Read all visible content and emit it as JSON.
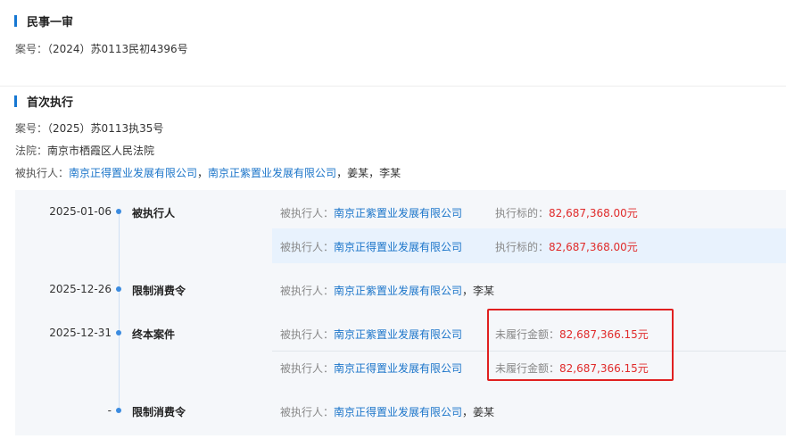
{
  "section1": {
    "title": "民事一审",
    "case_label": "案号：",
    "case_no": "（2024）苏0113民初4396号"
  },
  "section2": {
    "title": "首次执行",
    "case_label": "案号：",
    "case_no": "（2025）苏0113执35号",
    "court_label": "法院：",
    "court": "南京市栖霞区人民法院",
    "executed_label": "被执行人：",
    "executed_company1": "南京正得置业发展有限公司",
    "sep1": "，",
    "executed_company2": "南京正紫置业发展有限公司",
    "executed_rest": "，姜某，李某"
  },
  "timeline": [
    {
      "date": "2025-01-06",
      "type": "被执行人",
      "rows": [
        {
          "label": "被执行人：",
          "company": "南京正紫置业发展有限公司",
          "amount_label": "执行标的：",
          "amount": "82,687,368.00元"
        },
        {
          "label": "被执行人：",
          "company": "南京正得置业发展有限公司",
          "amount_label": "执行标的：",
          "amount": "82,687,368.00元"
        }
      ]
    },
    {
      "date": "2025-12-26",
      "type": "限制消费令",
      "rows": [
        {
          "label": "被执行人：",
          "company": "南京正紫置业发展有限公司",
          "suffix": "，李某"
        }
      ]
    },
    {
      "date": "2025-12-31",
      "type": "终本案件",
      "rows": [
        {
          "label": "被执行人：",
          "company": "南京正紫置业发展有限公司",
          "amount_label": "未履行金额：",
          "amount": "82,687,366.15元"
        },
        {
          "label": "被执行人：",
          "company": "南京正得置业发展有限公司",
          "amount_label": "未履行金额：",
          "amount": "82,687,366.15元"
        }
      ]
    },
    {
      "date": "-",
      "type": "限制消费令",
      "rows": [
        {
          "label": "被执行人：",
          "company": "南京正得置业发展有限公司",
          "suffix": "，姜某"
        }
      ]
    }
  ],
  "colors": {
    "accent": "#1677d2",
    "link": "#1a74c9",
    "amount": "#e02b2b",
    "highlight_box": "#e02020"
  }
}
